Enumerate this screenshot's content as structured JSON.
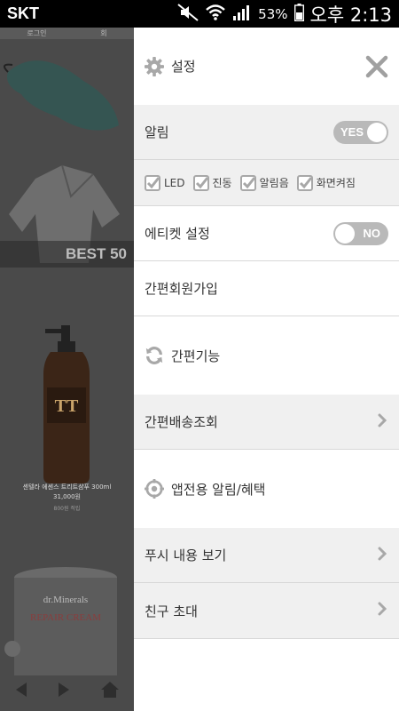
{
  "status_bar": {
    "carrier": "SKT",
    "battery_percent": "53%",
    "time": "오후 2:13"
  },
  "background_app": {
    "top_links": [
      "로그인",
      "회"
    ],
    "banner_text": "BEST 50",
    "product_name": "셴텔라 에센스 트리트샴푸 300ml",
    "product_price": "31,000원",
    "product_count": "800원 적립",
    "jar_brand": "dr.Minerals",
    "jar_title": "REPAIR CREAM"
  },
  "drawer": {
    "header": {
      "title": "설정",
      "icon": "gear-icon"
    },
    "notification": {
      "label": "알림",
      "toggle_label": "YES",
      "state": "on"
    },
    "options": [
      {
        "label": "LED",
        "checked": true
      },
      {
        "label": "진동",
        "checked": true
      },
      {
        "label": "알림음",
        "checked": true
      },
      {
        "label": "화면켜짐",
        "checked": true
      }
    ],
    "etiquette": {
      "label": "에티켓 설정",
      "toggle_label": "NO",
      "state": "off"
    },
    "simple_signup": {
      "label": "간편회원가입"
    },
    "simple_features": {
      "label": "간편기능",
      "icon": "refresh-icon"
    },
    "delivery_lookup": {
      "label": "간편배송조회"
    },
    "app_alerts": {
      "label": "앱전용 알림/혜택",
      "icon": "target-icon"
    },
    "push_view": {
      "label": "푸시 내용 보기"
    },
    "invite_friend": {
      "label": "친구 초대"
    }
  },
  "colors": {
    "toggle_gray": "#b9b9b9",
    "drawer_gray_row": "#f0f0f0",
    "check_gray": "#a8a8a8",
    "overlay_dim": "#4a4a4a"
  }
}
